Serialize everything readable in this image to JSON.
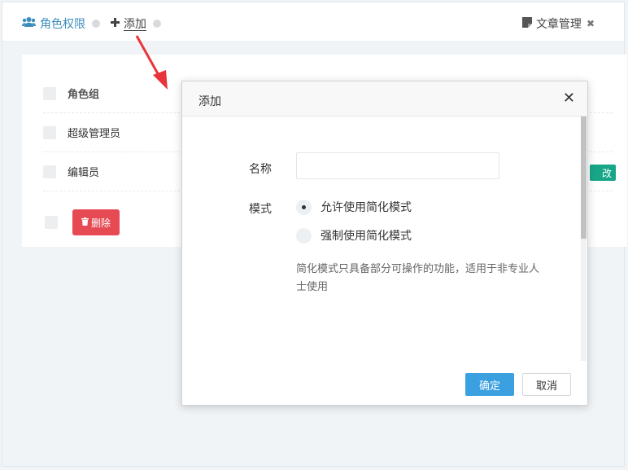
{
  "tabs": {
    "roles": {
      "label": "角色权限",
      "icon": "users-icon"
    },
    "add": {
      "label": "添加",
      "icon": "plus-icon"
    },
    "articles": {
      "label": "文章管理",
      "icon": "document-icon"
    }
  },
  "table": {
    "header": "角色组",
    "rows": [
      "超级管理员",
      "编辑员"
    ],
    "delete_label": "删除",
    "partial_tag": "改"
  },
  "modal": {
    "title": "添加",
    "name_label": "名称",
    "name_value": "",
    "mode_label": "模式",
    "options": [
      {
        "label": "允许使用简化模式",
        "selected": true
      },
      {
        "label": "强制使用简化模式",
        "selected": false
      }
    ],
    "help_text": "简化模式只具备部分可操作的功能，适用于非专业人士使用",
    "ok_label": "确定",
    "cancel_label": "取消"
  },
  "colors": {
    "accent": "#3c8dbc",
    "danger": "#e64b54",
    "primary_button": "#3aa0e0",
    "arrow": "#e8353b"
  }
}
